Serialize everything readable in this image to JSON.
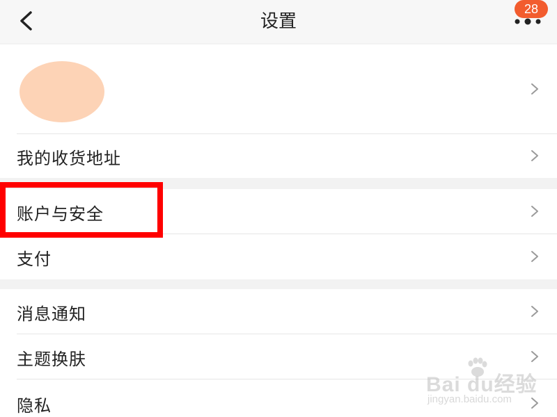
{
  "header": {
    "title": "设置",
    "back_icon": "chevron-left-icon",
    "more_icon": "more-dots-icon",
    "badge_count": "28",
    "badge_color": "#f25c2e"
  },
  "profile": {
    "avatar_color": "#fdd3b6",
    "chevron_icon": "chevron-right-icon"
  },
  "groups": [
    {
      "items": [
        {
          "label": "我的收货地址"
        }
      ]
    },
    {
      "items": [
        {
          "label": "账户与安全"
        },
        {
          "label": "支付"
        }
      ]
    },
    {
      "items": [
        {
          "label": "消息通知"
        },
        {
          "label": "主题换肤"
        },
        {
          "label": "隐私"
        }
      ]
    }
  ],
  "annotation": {
    "highlight_color": "#ff0000"
  },
  "watermark": {
    "main": "Bai du经验",
    "sub": "jingyan.baidu.com"
  }
}
